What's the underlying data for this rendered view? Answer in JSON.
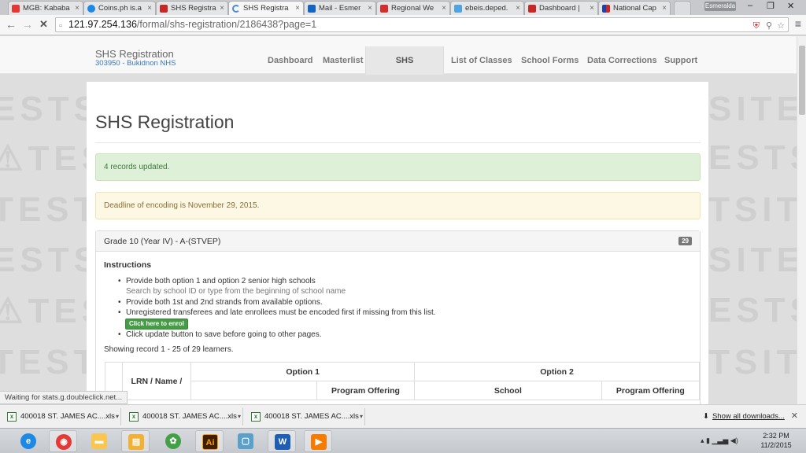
{
  "browser": {
    "tabs": [
      {
        "title": "MGB: Kababa",
        "icon": "youtube-icon",
        "color": "#e53935"
      },
      {
        "title": "Coins.ph is.a",
        "icon": "coins-icon",
        "color": "#1e88e5"
      },
      {
        "title": "SHS Registra",
        "icon": "deped-icon",
        "color": "#c62828"
      },
      {
        "title": "SHS Registra",
        "icon": "loading-icon",
        "color": "#4a8ad4"
      },
      {
        "title": "Mail - Esmer",
        "icon": "mail-icon",
        "color": "#1565c0"
      },
      {
        "title": "Regional We",
        "icon": "gmail-icon",
        "color": "#d32f2f"
      },
      {
        "title": "ebeis.deped.",
        "icon": "ebeis-icon",
        "color": "#4fa3e0"
      },
      {
        "title": "Dashboard |",
        "icon": "deped-icon",
        "color": "#c62828"
      },
      {
        "title": "National Cap",
        "icon": "flag-icon",
        "color": "#1e40af"
      }
    ],
    "user_badge": "Esmeralda",
    "url_host": "121.97.254.136",
    "url_path": "/formal/shs-registration/2186438?page=1"
  },
  "app": {
    "brand_title": "SHS Registration",
    "brand_subtitle": "303950 - Bukidnon NHS",
    "nav": [
      "Dashboard",
      "Masterlist",
      "SHS Registration",
      "List of Classes",
      "School Forms",
      "Data Corrections",
      "Support"
    ],
    "active_nav": "SHS Registration"
  },
  "page": {
    "title": "SHS Registration",
    "alert_success": "4 records updated.",
    "alert_warning": "Deadline of encoding is November 29, 2015.",
    "grade_title": "Grade 10 (Year IV) - A-(STVEP)",
    "grade_count": "29",
    "instructions_title": "Instructions",
    "instructions": [
      "Provide both option 1 and option 2 senior high schools",
      "Search by school ID or type from the beginning of school name",
      "Provide both 1st and 2nd strands from available options.",
      "Unregistered transferees and late enrollees must be encoded first if missing from this list.",
      "Click update button to save before going to other pages."
    ],
    "enrol_button": "Click here to enrol",
    "showing": "Showing record 1 - 25 of 29 learners."
  },
  "table": {
    "col_lrn": "LRN / Name /",
    "option1": "Option 1",
    "option2": "Option 2",
    "program_offering": "Program Offering",
    "school": "School"
  },
  "status_bubble": "Waiting for stats.g.doubleclick.net...",
  "downloads": {
    "items": [
      "400018 ST. JAMES AC....xls",
      "400018 ST. JAMES AC....xls",
      "400018 ST. JAMES AC....xls"
    ],
    "show_all": "Show all downloads..."
  },
  "taskbar": {
    "time": "2:32 PM",
    "date": "11/2/2015",
    "apps": [
      {
        "name": "ie-icon",
        "color": "#1e88e5",
        "label": "e"
      },
      {
        "name": "chrome-icon",
        "color": "#e53935",
        "label": "◉"
      },
      {
        "name": "folder-icon",
        "color": "#f9c74f",
        "label": "▬"
      },
      {
        "name": "explorer-icon",
        "color": "#f2b134",
        "label": "▤"
      },
      {
        "name": "atom-icon",
        "color": "#43a047",
        "label": "✿"
      },
      {
        "name": "illustrator-icon",
        "color": "#3d1f00",
        "label": "Ai"
      },
      {
        "name": "window-app-icon",
        "color": "#5aa0c8",
        "label": "▢"
      },
      {
        "name": "word-icon",
        "color": "#1e5fb4",
        "label": "W"
      },
      {
        "name": "media-player-icon",
        "color": "#f57c00",
        "label": "▶"
      }
    ]
  }
}
